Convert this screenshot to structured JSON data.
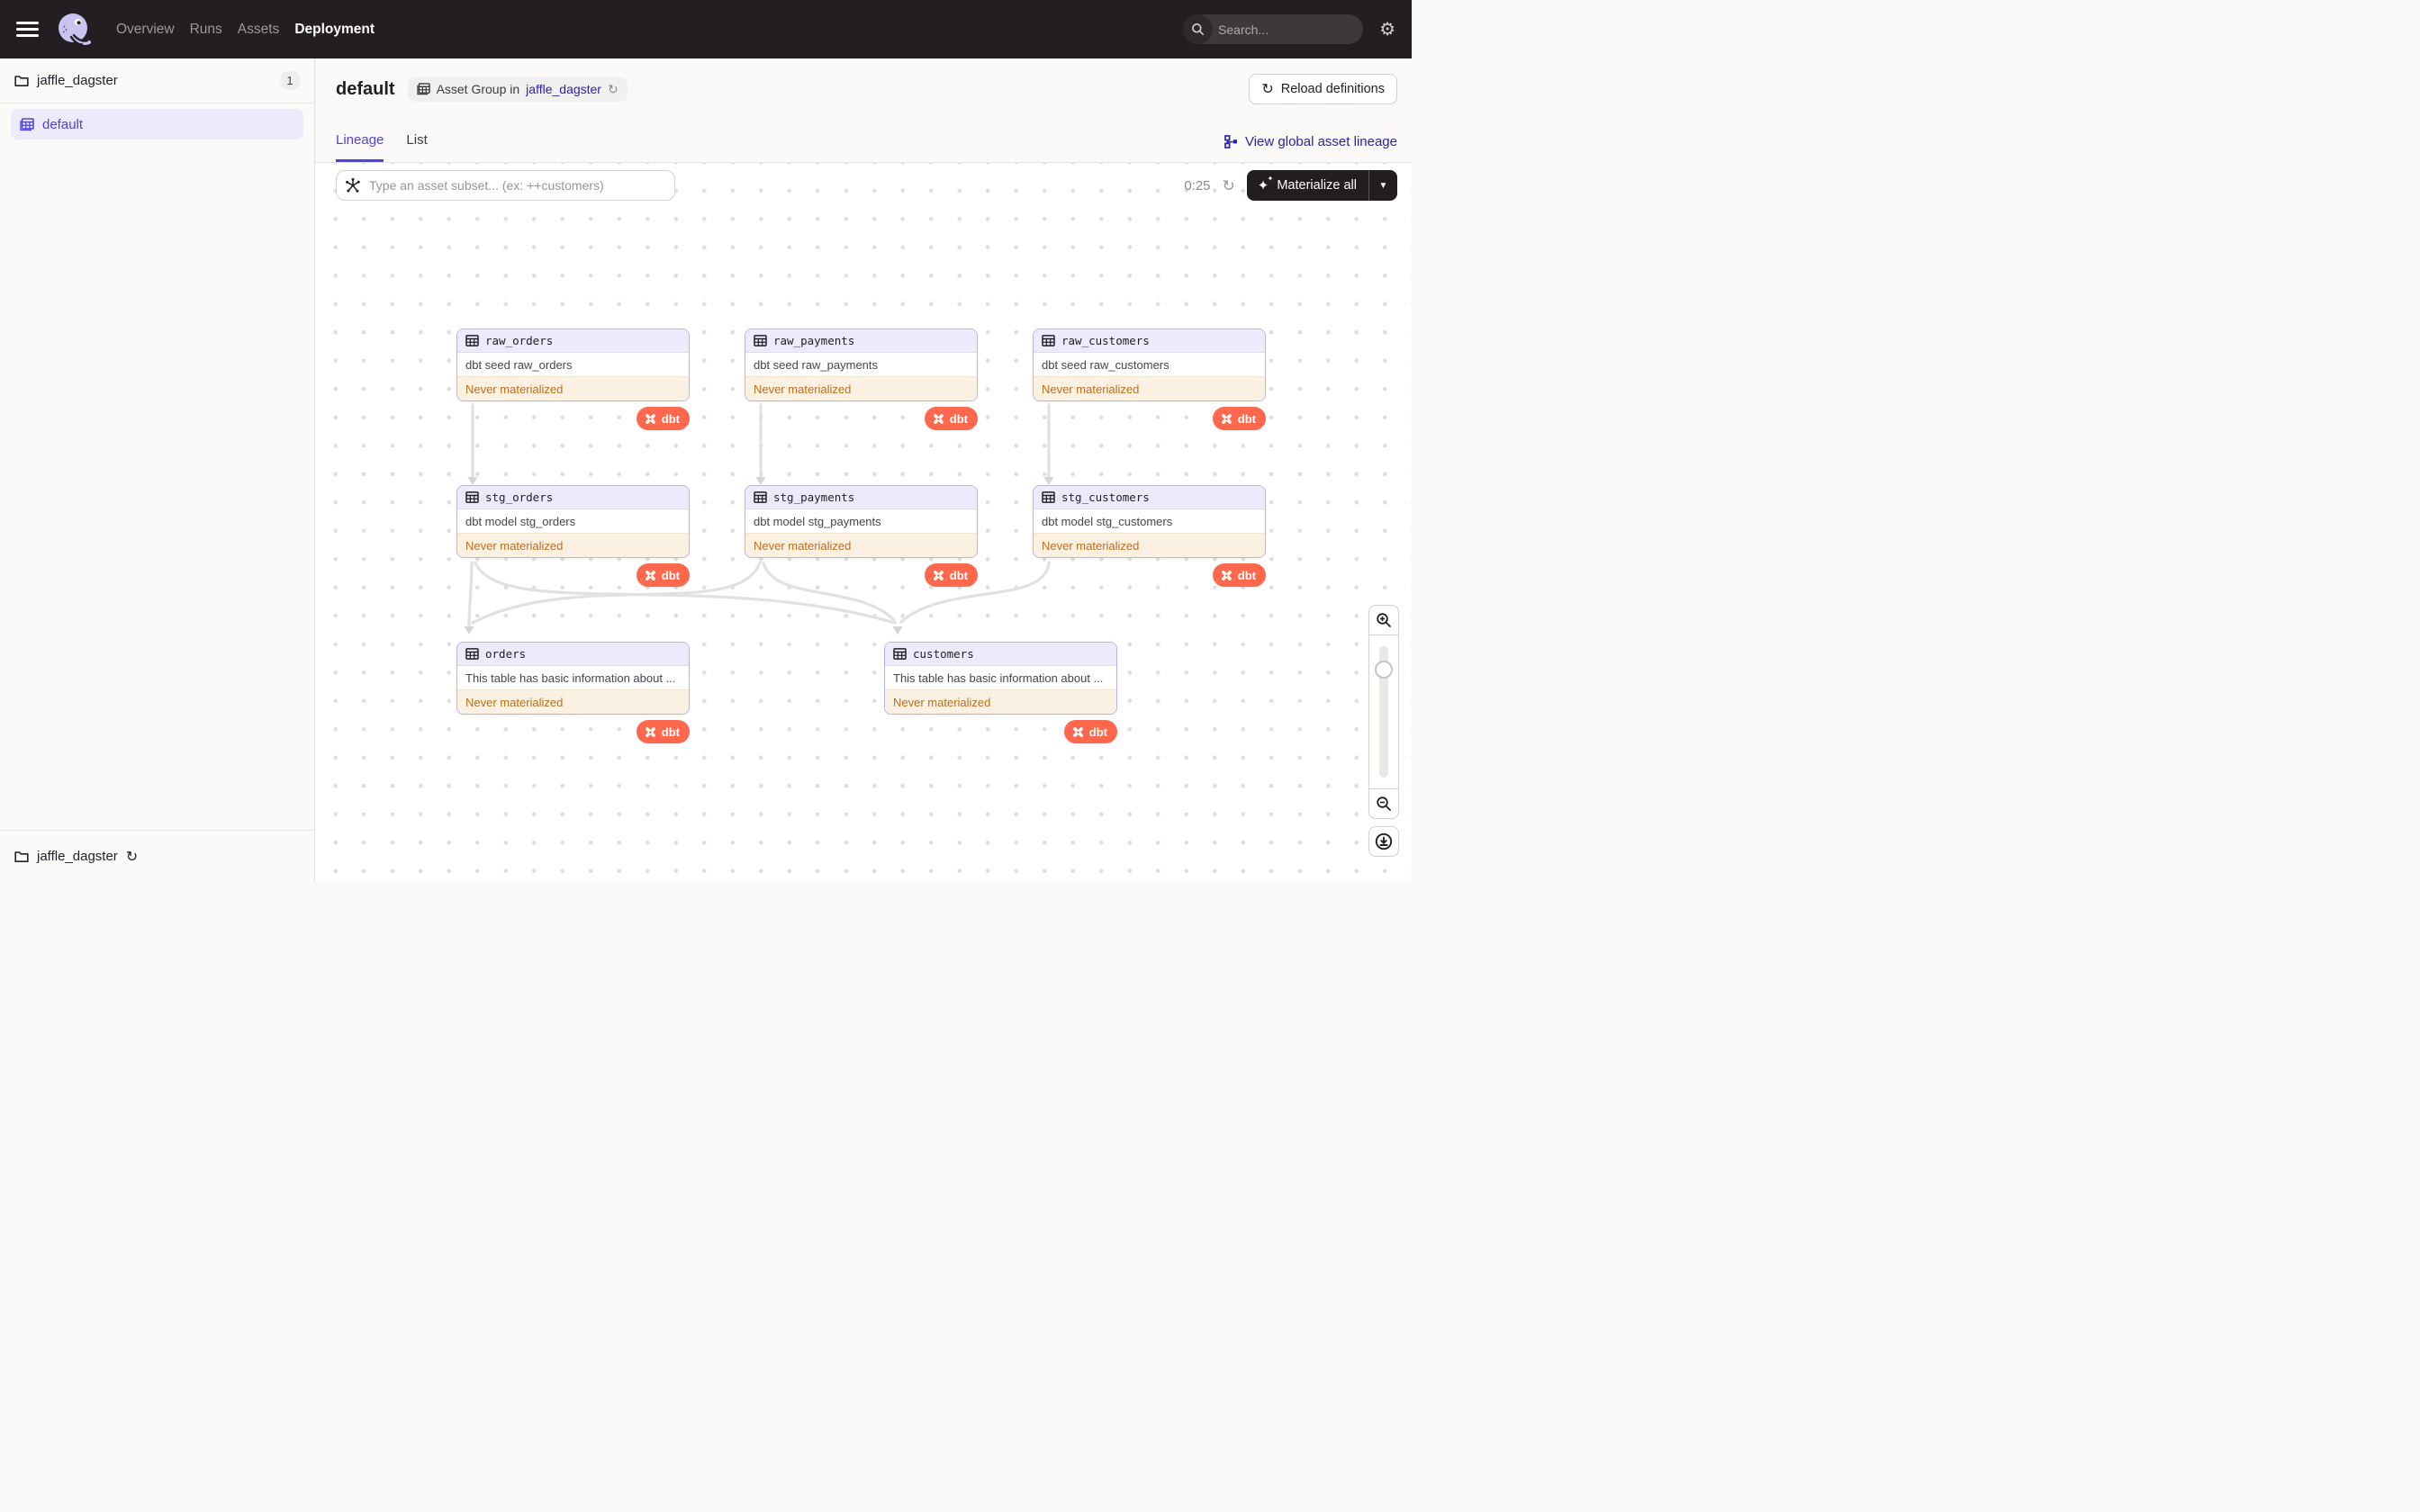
{
  "nav": {
    "items": [
      "Overview",
      "Runs",
      "Assets",
      "Deployment"
    ],
    "active_item": "Deployment",
    "search": {
      "placeholder": "Search...",
      "shortcut": "/"
    }
  },
  "sidebar": {
    "project": {
      "name": "jaffle_dagster",
      "count": "1"
    },
    "selected_group": "default",
    "footer": {
      "name": "jaffle_dagster"
    }
  },
  "header": {
    "title": "default",
    "badge": {
      "prefix": "Asset Group in",
      "link": "jaffle_dagster"
    },
    "reload_button": "Reload definitions"
  },
  "tabs": {
    "items": [
      "Lineage",
      "List"
    ],
    "active": "Lineage",
    "global_link": "View global asset lineage"
  },
  "toolbar": {
    "filter_placeholder": "Type an asset subset... (ex: ++customers)",
    "timer": "0:25",
    "materialize": "Materialize all"
  },
  "graph": {
    "status_label": "Never materialized",
    "compute_badge": "dbt",
    "nodes": [
      {
        "id": "raw_orders",
        "name": "raw_orders",
        "description": "dbt seed raw_orders"
      },
      {
        "id": "raw_payments",
        "name": "raw_payments",
        "description": "dbt seed raw_payments"
      },
      {
        "id": "raw_customers",
        "name": "raw_customers",
        "description": "dbt seed raw_customers"
      },
      {
        "id": "stg_orders",
        "name": "stg_orders",
        "description": "dbt model stg_orders"
      },
      {
        "id": "stg_payments",
        "name": "stg_payments",
        "description": "dbt model stg_payments"
      },
      {
        "id": "stg_customers",
        "name": "stg_customers",
        "description": "dbt model stg_customers"
      },
      {
        "id": "orders",
        "name": "orders",
        "description": "This table has basic information about ..."
      },
      {
        "id": "customers",
        "name": "customers",
        "description": "This table has basic information about ..."
      }
    ],
    "edges": [
      [
        "raw_orders",
        "stg_orders"
      ],
      [
        "raw_payments",
        "stg_payments"
      ],
      [
        "raw_customers",
        "stg_customers"
      ],
      [
        "stg_orders",
        "orders"
      ],
      [
        "stg_orders",
        "customers"
      ],
      [
        "stg_payments",
        "orders"
      ],
      [
        "stg_payments",
        "customers"
      ],
      [
        "stg_customers",
        "customers"
      ]
    ]
  },
  "colors": {
    "accent": "#4F43DD",
    "link": "#2724A5",
    "dbt_orange": "#FF684C",
    "status_text": "#BA6E1E",
    "status_bg": "#FBF1E2",
    "node_border": "#B8B3EF",
    "node_header_bg": "#ECEBFB",
    "nav_bg": "#221E21"
  }
}
